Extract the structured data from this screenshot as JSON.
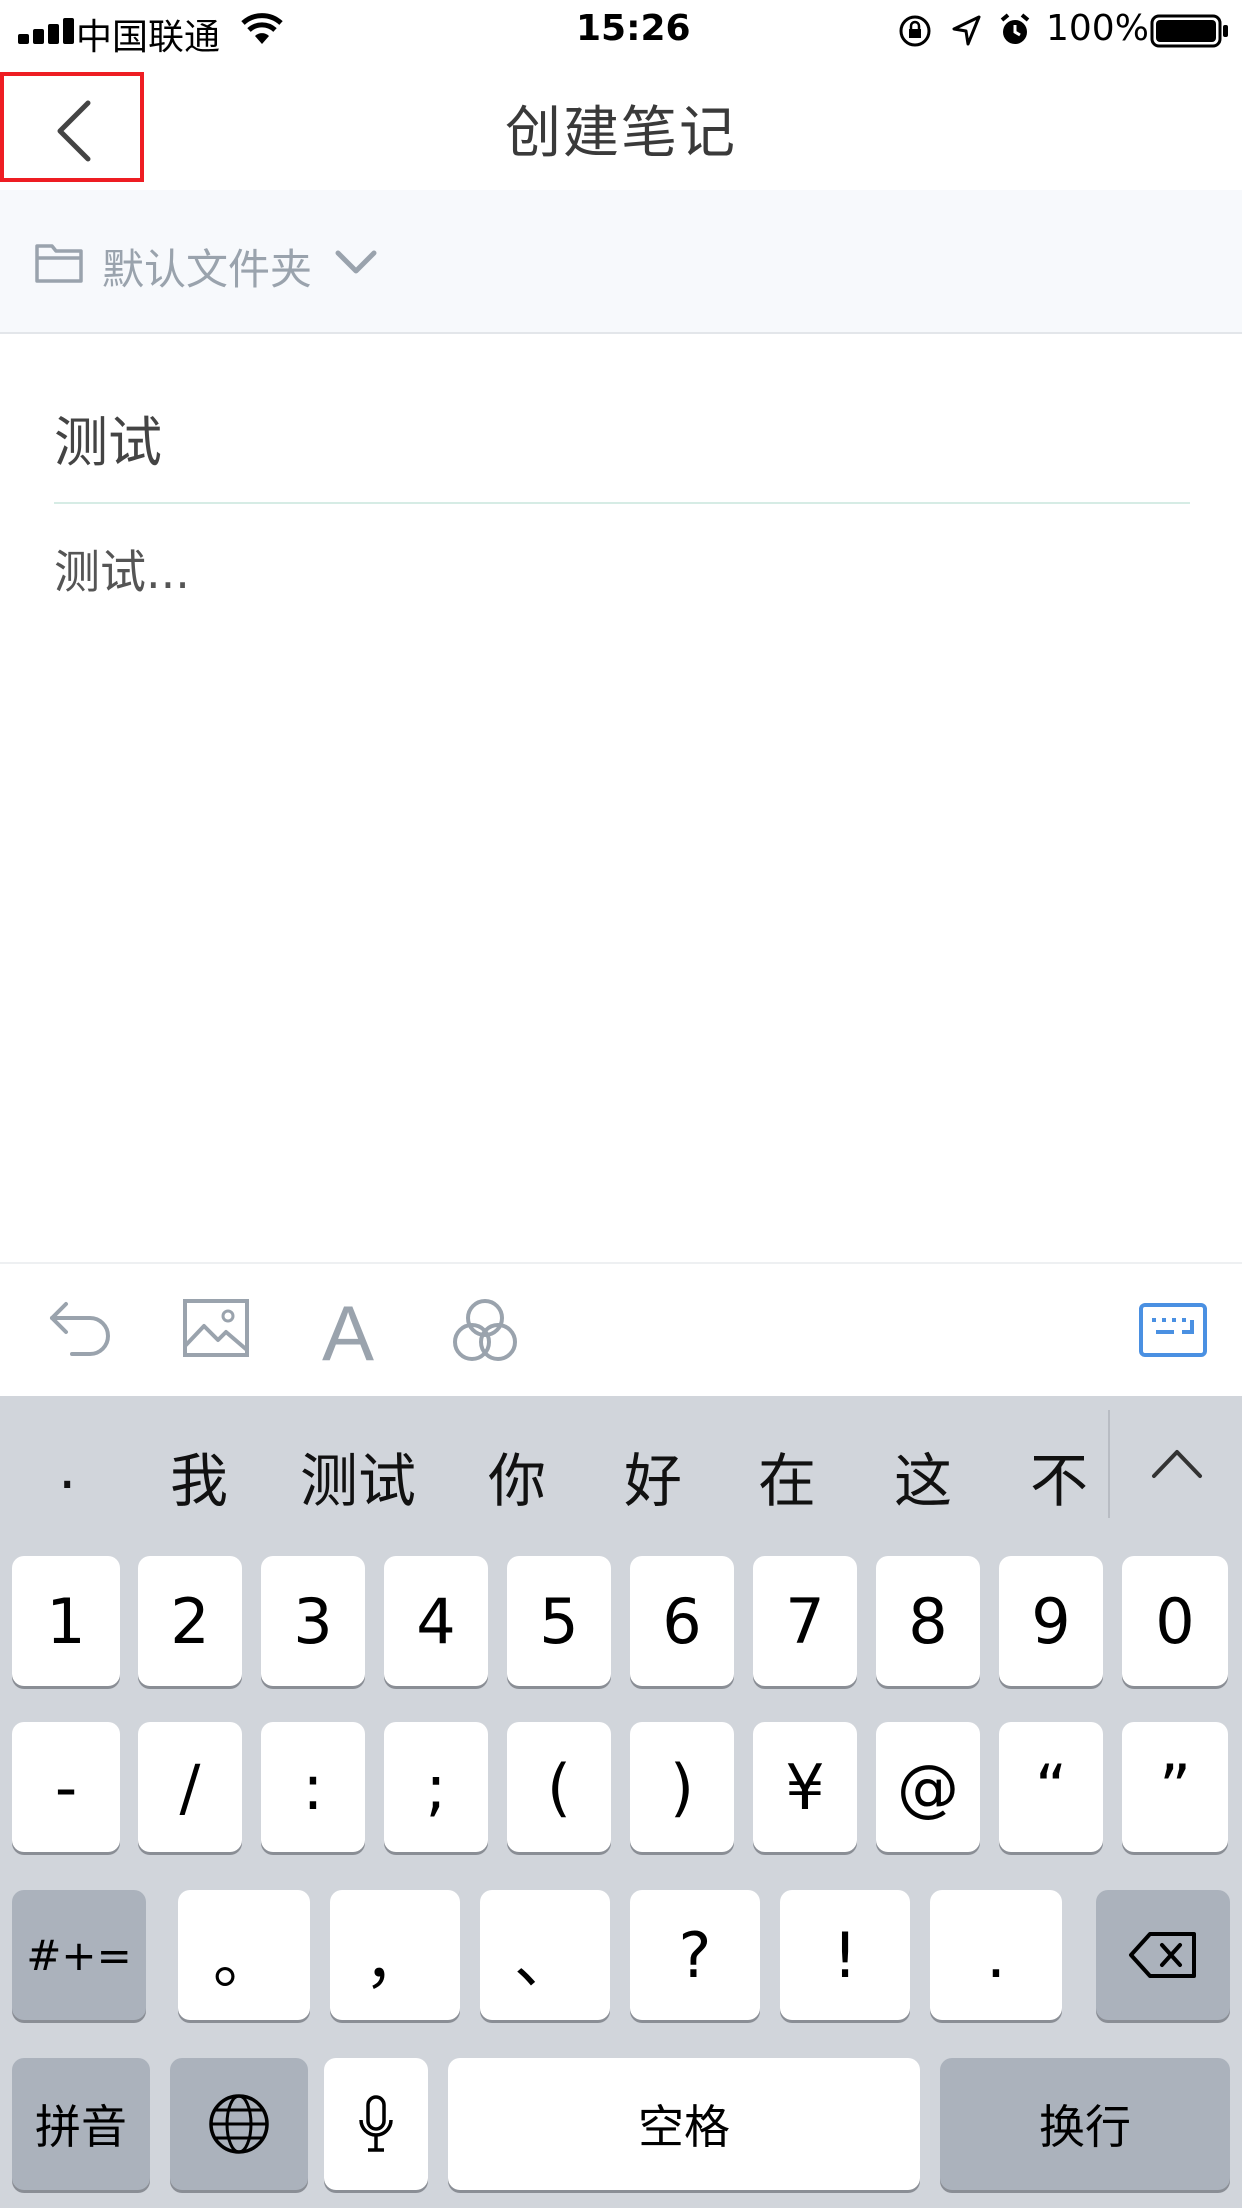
{
  "status_bar": {
    "carrier": "中国联通",
    "time": "15:26",
    "battery": "100%"
  },
  "nav": {
    "title": "创建笔记",
    "back_icon": "chevron-left-icon"
  },
  "folder": {
    "label": "默认文件夹",
    "icon": "folder-icon",
    "dropdown_icon": "chevron-down-icon"
  },
  "note": {
    "title": "测试",
    "body": "测试..."
  },
  "toolbar": {
    "icons": [
      "undo-icon",
      "image-icon",
      "text-format-icon",
      "color-circles-icon",
      "keyboard-hide-icon"
    ],
    "text_format_glyph": "A",
    "accent_color": "#4a90e2"
  },
  "keyboard": {
    "candidates": [
      ".",
      "我",
      "测试",
      "你",
      "好",
      "在",
      "这",
      "不"
    ],
    "row1": [
      "1",
      "2",
      "3",
      "4",
      "5",
      "6",
      "7",
      "8",
      "9",
      "0"
    ],
    "row2": [
      "-",
      "/",
      ":",
      ";",
      "(",
      ")",
      "¥",
      "@",
      "“",
      "”"
    ],
    "row3_toggle": "#+=",
    "row3": [
      "。",
      "，",
      "、",
      "?",
      "!",
      "."
    ],
    "pinyin": "拼音",
    "space": "空格",
    "return": "换行"
  }
}
